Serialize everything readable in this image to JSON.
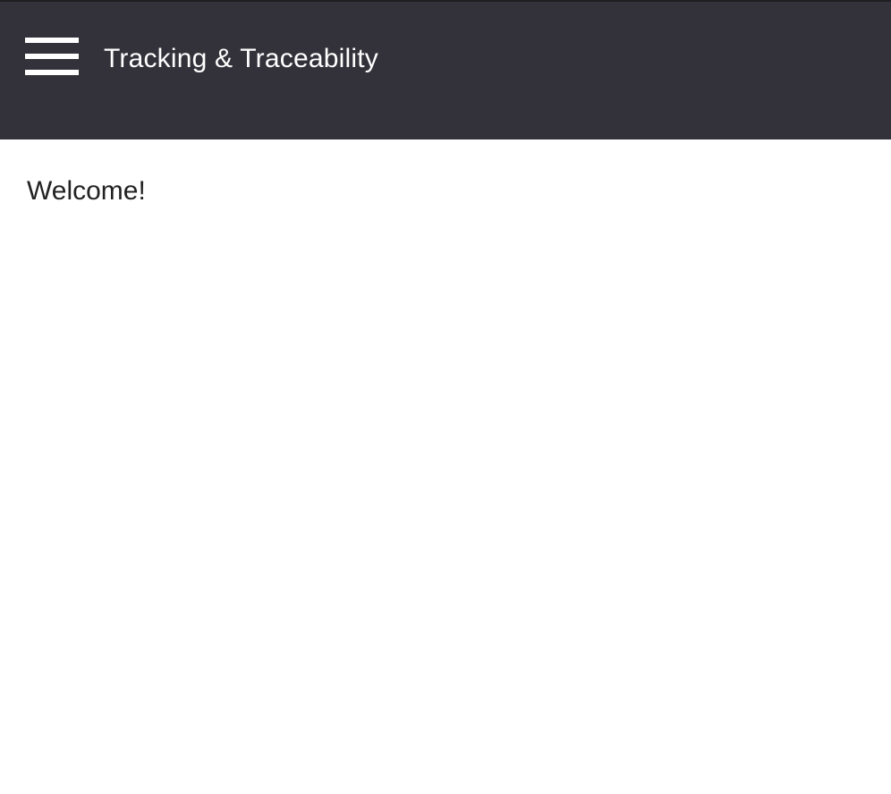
{
  "header": {
    "title": "Tracking & Traceability",
    "menu_icon": "hamburger-menu-icon"
  },
  "main": {
    "welcome_text": "Welcome!"
  },
  "colors": {
    "header_background": "#33323a",
    "header_text": "#ffffff",
    "body_background": "#ffffff",
    "body_text": "#222222"
  }
}
